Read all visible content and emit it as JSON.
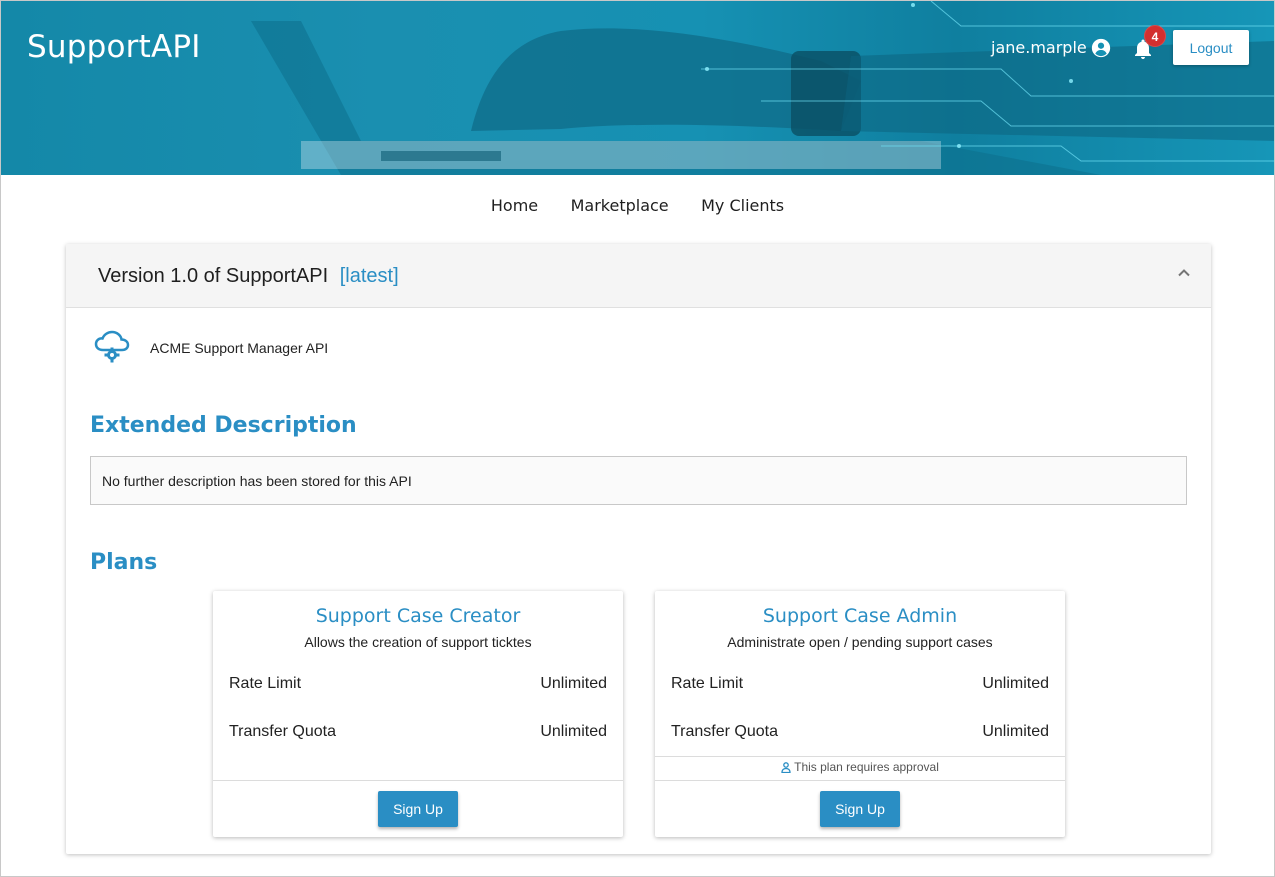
{
  "header": {
    "brand": "SupportAPI",
    "username": "jane.marple",
    "notification_count": "4",
    "logout_label": "Logout"
  },
  "nav": {
    "items": [
      {
        "label": "Home"
      },
      {
        "label": "Marketplace"
      },
      {
        "label": "My Clients"
      }
    ]
  },
  "panel": {
    "title": "Version 1.0 of SupportAPI",
    "tag": "[latest]",
    "api_description": "ACME Support Manager API",
    "extended_title": "Extended Description",
    "extended_text": "No further description has been stored for this API",
    "plans_title": "Plans"
  },
  "plans": [
    {
      "name": "Support Case Creator",
      "description": "Allows the creation of support ticktes",
      "rate_limit_label": "Rate Limit",
      "rate_limit_value": "Unlimited",
      "transfer_quota_label": "Transfer Quota",
      "transfer_quota_value": "Unlimited",
      "signup_label": "Sign Up"
    },
    {
      "name": "Support Case Admin",
      "description": "Administrate open / pending support cases",
      "rate_limit_label": "Rate Limit",
      "rate_limit_value": "Unlimited",
      "transfer_quota_label": "Transfer Quota",
      "transfer_quota_value": "Unlimited",
      "approval_note": "This plan requires approval",
      "signup_label": "Sign Up"
    }
  ],
  "colors": {
    "accent": "#2a8ec4",
    "header_bg": "#1691b3",
    "badge": "#d32f2f"
  },
  "icons": {
    "user": "account-circle-icon",
    "bell": "bell-icon",
    "collapse": "chevron-up-icon",
    "api": "cloud-gear-icon",
    "approval": "person-icon"
  }
}
